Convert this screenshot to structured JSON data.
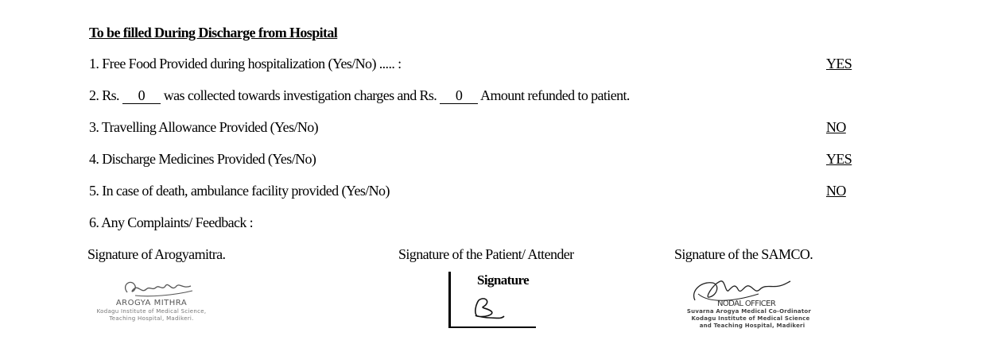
{
  "section_title": "To be filled During Discharge from Hospital",
  "items": [
    {
      "text": "1. Free Food Provided during hospitalization (Yes/No) ..... :",
      "answer": "YES"
    },
    {
      "prefix": "2. Rs.",
      "amount_collected": "0",
      "middle": "was collected towards investigation charges and Rs.",
      "amount_refunded": "0",
      "suffix": "Amount refunded to patient."
    },
    {
      "text": "3. Travelling Allowance Provided (Yes/No)",
      "answer": "NO"
    },
    {
      "text": "4. Discharge Medicines Provided (Yes/No)",
      "answer": "YES"
    },
    {
      "text": "5. In case of death, ambulance facility provided (Yes/No)",
      "answer": "NO"
    },
    {
      "text": "6. Any Complaints/ Feedback :"
    }
  ],
  "signatures": {
    "arogyamitra": {
      "label": "Signature of Arogyamitra.",
      "stamp_lines": [
        "AROGYA MITHRA",
        "Kodagu Institute of Medical Science,",
        "Teaching Hospital, Madikeri."
      ]
    },
    "patient": {
      "label": "Signature of the Patient/ Attender",
      "box_title": "Signature"
    },
    "samco": {
      "label": "Signature of the SAMCO.",
      "stamp_lines": [
        "NODAL OFFICER",
        "Suvarna Arogya Medical Co-Ordinator",
        "Kodagu Institute of Medical Science",
        "and Teaching Hospital, Madikeri"
      ]
    }
  }
}
